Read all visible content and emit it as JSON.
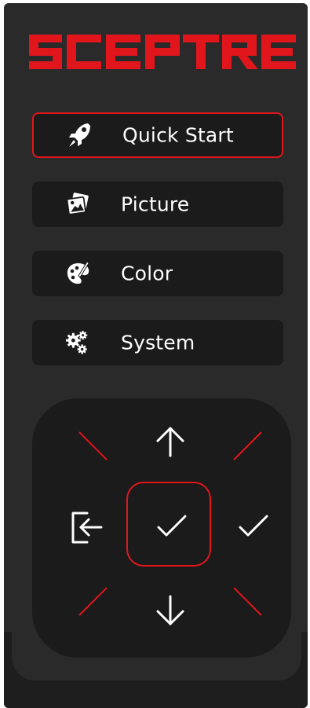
{
  "brand": {
    "name": "SCEPTRE",
    "color": "#e0161c"
  },
  "colors": {
    "panel": "#2a2a2a",
    "button": "#1b1b1b",
    "accent": "#e0161c",
    "text": "#ffffff"
  },
  "menu": {
    "items": [
      {
        "label": "Quick Start",
        "icon": "rocket-icon",
        "active": true
      },
      {
        "label": "Picture",
        "icon": "pictures-icon",
        "active": false
      },
      {
        "label": "Color",
        "icon": "palette-icon",
        "active": false
      },
      {
        "label": "System",
        "icon": "gears-icon",
        "active": false
      }
    ]
  },
  "dpad": {
    "up": "arrow-up-icon",
    "down": "arrow-down-icon",
    "left": "exit-icon",
    "right": "checkmark-icon",
    "center": "checkmark-icon",
    "diagonals": "red-diagonal-lines"
  }
}
